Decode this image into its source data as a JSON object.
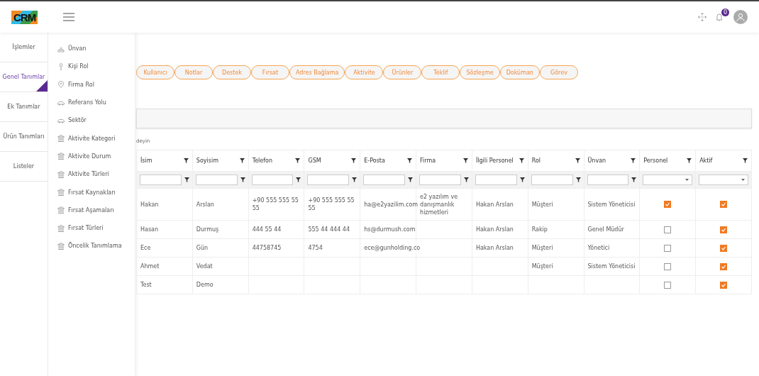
{
  "header": {
    "logo": "CRM",
    "notification_count": "0"
  },
  "sidebar": {
    "items": [
      {
        "label": "İşlemler",
        "selected": false
      },
      {
        "label": "Genel Tanımlar",
        "selected": true
      },
      {
        "label": "Ek Tanımlar",
        "selected": false
      },
      {
        "label": "Ürün Tanımları",
        "selected": false
      },
      {
        "label": "Listeler",
        "selected": false
      }
    ]
  },
  "submenu": {
    "items": [
      {
        "label": "Ünvan",
        "kind": "cake"
      },
      {
        "label": "Kişi Rol",
        "kind": "mic"
      },
      {
        "label": "Firma Rol",
        "kind": "pin"
      },
      {
        "label": "Referans Yolu",
        "kind": "car"
      },
      {
        "label": "Sektör",
        "kind": "car"
      },
      {
        "label": "Aktivite Kategori",
        "kind": "bank"
      },
      {
        "label": "Aktivite Durum",
        "kind": "bank"
      },
      {
        "label": "Aktivite Türleri",
        "kind": "bank"
      },
      {
        "label": "Fırsat Kaynakları",
        "kind": "bank"
      },
      {
        "label": "Fırsat Aşamaları",
        "kind": "bank"
      },
      {
        "label": "Fırsat Türleri",
        "kind": "bank"
      },
      {
        "label": "Öncelik Tanımlama",
        "kind": "bank"
      }
    ]
  },
  "tabs": [
    {
      "label": "Kullanıcı",
      "selected": false
    },
    {
      "label": "Notlar",
      "selected": false
    },
    {
      "label": "Destek",
      "selected": false
    },
    {
      "label": "Fırsat",
      "selected": false
    },
    {
      "label": "Adres Bağlama",
      "selected": false
    },
    {
      "label": "Aktivite",
      "selected": false
    },
    {
      "label": "Ürünler",
      "selected": false
    },
    {
      "label": "Teklif",
      "selected": false
    },
    {
      "label": "Sözleşme",
      "selected": false
    },
    {
      "label": "Doküman",
      "selected": false
    },
    {
      "label": "Görev",
      "selected": false
    }
  ],
  "hint": "deyin",
  "table": {
    "columns": [
      {
        "label": "İsim",
        "kind": "text"
      },
      {
        "label": "Soyisim",
        "kind": "text"
      },
      {
        "label": "Telefon",
        "kind": "text"
      },
      {
        "label": "GSM",
        "kind": "text"
      },
      {
        "label": "E-Posta",
        "kind": "text"
      },
      {
        "label": "Firma",
        "kind": "text"
      },
      {
        "label": "İlgili Personel",
        "kind": "text"
      },
      {
        "label": "Rol",
        "kind": "text"
      },
      {
        "label": "Ünvan",
        "kind": "text"
      },
      {
        "label": "Personel",
        "kind": "select"
      },
      {
        "label": "Aktif",
        "kind": "select"
      }
    ],
    "rows": [
      {
        "isim": "Hakan",
        "soyisim": "Arslan",
        "telefon": "+90 555 555 55 55",
        "gsm": "+90 555 555 55 55",
        "eposta": "ha@e2yazilim.com",
        "firma": "e2 yazılım ve danışmanlık hizmetleri",
        "ilgili_personel": "Hakan Arslan",
        "rol": "Müşteri",
        "unvan": "Sistem Yöneticisi",
        "personel": true,
        "aktif": true
      },
      {
        "isim": "Hasan",
        "soyisim": "Durmuş",
        "telefon": "444 55 44",
        "gsm": "555 44 444 44",
        "eposta": "hs@durmush.com",
        "ilgili_personel": "Hakan Arslan",
        "rol": "Rakip",
        "unvan": "Genel Müdür",
        "personel": false,
        "aktif": true
      },
      {
        "isim": "Ece",
        "soyisim": "Gün",
        "telefon": "44758745",
        "gsm": "4754",
        "eposta": "ece@gunholding.co",
        "ilgili_personel": "Hakan Arslan",
        "rol": "Müşteri",
        "unvan": "Yönetici",
        "personel": false,
        "aktif": true
      },
      {
        "isim": "Ahmet",
        "soyisim": "Vedat",
        "rol": "Müşteri",
        "unvan": "Sistem Yöneticisi",
        "personel": false,
        "aktif": true
      },
      {
        "isim": "Test",
        "soyisim": "Demo",
        "personel": false,
        "aktif": true
      }
    ]
  }
}
